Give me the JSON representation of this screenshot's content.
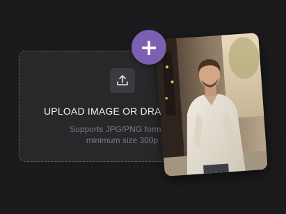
{
  "dropzone": {
    "title": "UPLOAD IMAGE OR DRA",
    "subtitle_line1": "Supports JPG/PNG formats,",
    "subtitle_line2": "minimum size 300p",
    "icon": "upload-icon"
  },
  "add_button": {
    "label": "+",
    "color": "#7a5fb3"
  },
  "preview": {
    "icon": "photo-of-man-in-white-shirt"
  },
  "colors": {
    "background": "#1b1b1d",
    "panel": "#28282b",
    "accent": "#7a5fb3"
  }
}
